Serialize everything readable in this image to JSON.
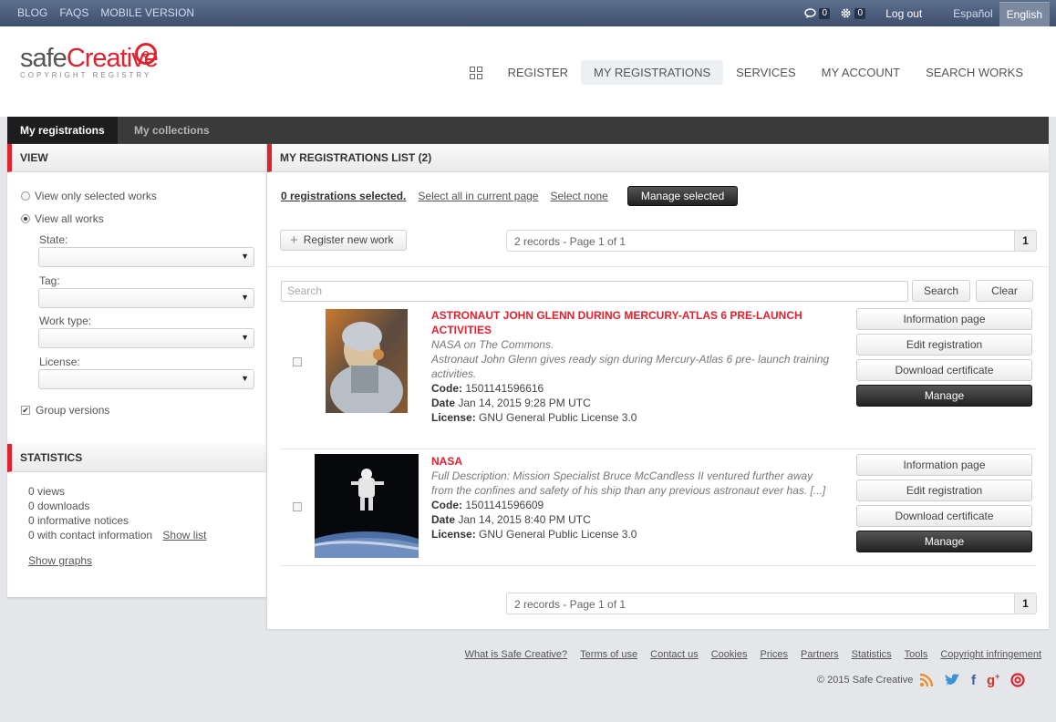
{
  "topbar": {
    "links": [
      "BLOG",
      "FAQS",
      "MOBILE VERSION"
    ],
    "messages_count": "0",
    "settings_count": "0",
    "logout": "Log out",
    "lang_es": "Español",
    "lang_en": "English"
  },
  "logo": {
    "word_a": "safe",
    "word_b": "Creative",
    "sub": "COPYRIGHT REGISTRY"
  },
  "nav": [
    "REGISTER",
    "MY REGISTRATIONS",
    "SERVICES",
    "MY ACCOUNT",
    "SEARCH WORKS"
  ],
  "tabs": {
    "active": "My registrations",
    "inactive": "My collections"
  },
  "sidebar": {
    "view_title": "VIEW",
    "radio_selected": "View only selected works",
    "radio_all": "View all works",
    "state_label": "State:",
    "tag_label": "Tag:",
    "worktype_label": "Work type:",
    "license_label": "License:",
    "group_versions": "Group versions",
    "stats_title": "STATISTICS",
    "views": "0 views",
    "downloads": "0 downloads",
    "notices": "0 informative notices",
    "contact": "0 with contact information",
    "show_list": "Show list",
    "show_graphs": "Show graphs"
  },
  "main": {
    "title": "MY REGISTRATIONS LIST (2)",
    "selected_count": "0 registrations selected.",
    "select_all": "Select all in current page",
    "select_none": "Select none",
    "manage_selected": "Manage selected",
    "register_new": "Register new work",
    "pager_text": "2 records - Page 1 of 1",
    "pager_page": "1",
    "search_placeholder": "Search",
    "search_btn": "Search",
    "clear_btn": "Clear",
    "items": [
      {
        "title": "ASTRONAUT JOHN GLENN DURING MERCURY-ATLAS 6 PRE-LAUNCH ACTIVITIES",
        "author": "NASA on The Commons.",
        "desc": "Astronaut John Glenn gives ready sign during Mercury-Atlas 6 pre- launch training activities.",
        "code_label": "Code:",
        "code": "1501141596616",
        "date_label": "Date",
        "date": "Jan 14, 2015 9:28 PM UTC",
        "license_label": "License:",
        "license": "GNU General Public License 3.0"
      },
      {
        "title": "NASA",
        "desc": "Full Description: Mission Specialist Bruce McCandless II ventured further away from the confines and safety of his ship than any previous astronaut ever has. [...]",
        "code_label": "Code:",
        "code": "1501141596609",
        "date_label": "Date",
        "date": "Jan 14, 2015 8:40 PM UTC",
        "license_label": "License:",
        "license": "GNU General Public License 3.0"
      }
    ],
    "actions": {
      "info": "Information page",
      "edit": "Edit registration",
      "download": "Download certificate",
      "manage": "Manage"
    }
  },
  "footer": {
    "links": [
      "What is Safe Creative?",
      "Terms of use",
      "Contact us",
      "Cookies",
      "Prices",
      "Partners",
      "Statistics",
      "Tools",
      "Copyright infringement"
    ],
    "copyright": "© 2015 Safe Creative"
  },
  "colors": {
    "brand_red": "#e1222e",
    "topbar": "#4a5c78",
    "dark": "#3a3a3a"
  }
}
